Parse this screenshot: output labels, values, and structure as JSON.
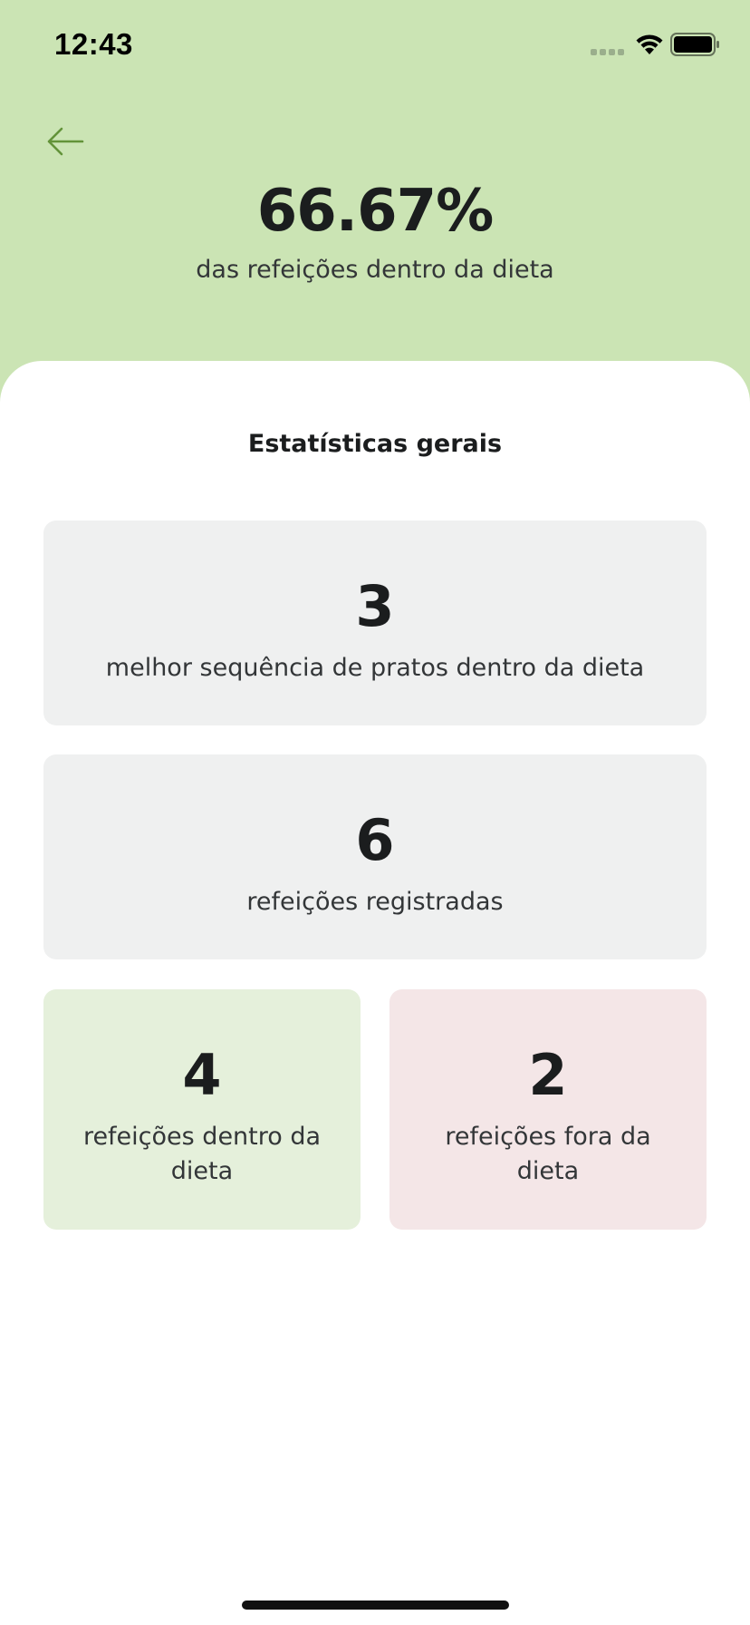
{
  "status_bar": {
    "time": "12:43"
  },
  "header": {
    "percent": "66.67%",
    "caption": "das refeições dentro da dieta",
    "background_color": "#CBE4B4",
    "back_icon": "arrow-left-icon",
    "back_icon_color": "#639339"
  },
  "stats": {
    "title": "Estatísticas gerais",
    "best_sequence": {
      "value": "3",
      "label": "melhor sequência de pratos dentro da dieta"
    },
    "total_meals": {
      "value": "6",
      "label": "refeições registradas"
    },
    "meals_in_diet": {
      "value": "4",
      "label": "refeições dentro da dieta",
      "color": "#E5F0DB"
    },
    "meals_out_diet": {
      "value": "2",
      "label": "refeições fora da dieta",
      "color": "#F4E6E7"
    }
  }
}
